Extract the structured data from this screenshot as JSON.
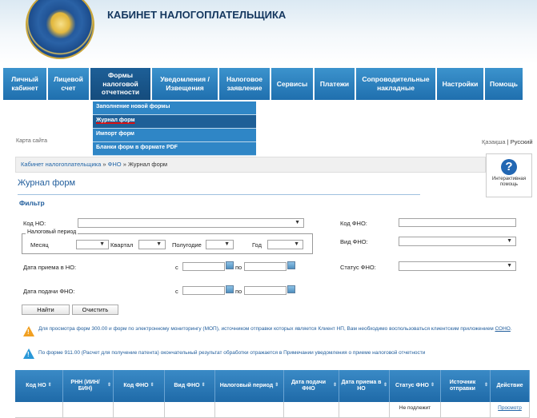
{
  "header": {
    "title": "КАБИНЕТ НАЛОГОПЛАТЕЛЬЩИКА"
  },
  "nav": {
    "items": [
      {
        "label": "Личный кабинет"
      },
      {
        "label": "Лицевой счет"
      },
      {
        "label": "Формы налоговой отчетности"
      },
      {
        "label": "Уведомления / Извещения"
      },
      {
        "label": "Налоговое заявление"
      },
      {
        "label": "Сервисы"
      },
      {
        "label": "Платежи"
      },
      {
        "label": "Сопроводительные накладные"
      },
      {
        "label": "Настройки"
      },
      {
        "label": "Помощь"
      }
    ]
  },
  "dropdown": {
    "items": [
      {
        "label": "Заполнение новой формы"
      },
      {
        "label": "Журнал форм"
      },
      {
        "label": "Импорт форм"
      },
      {
        "label": "Бланки форм в формате PDF"
      }
    ]
  },
  "sitemap": "Карта сайта",
  "lang": {
    "kz": "Қазақша",
    "sep": "|",
    "ru": "Русский"
  },
  "breadcrumb": {
    "home": "Кабинет налогоплательщика",
    "sep1": "»",
    "fno": "ФНО",
    "sep2": "»",
    "current": "Журнал форм"
  },
  "help": {
    "icon": "?",
    "label": "Интерактивная помощь"
  },
  "page": {
    "title": "Журнал форм"
  },
  "filter": {
    "heading": "Фильтр",
    "kod_no_label": "Код НО:",
    "period_legend": "Налоговый период",
    "month_label": "Месяц",
    "quarter_label": "Квартал",
    "halfyear_label": "Полугодие",
    "year_label": "Год",
    "date_received_label": "Дата приема в НО:",
    "date_submitted_label": "Дата подачи ФНО:",
    "from_label": "с",
    "to_label": "по",
    "kod_fno_label": "Код ФНО:",
    "vid_fno_label": "Вид ФНО:",
    "status_fno_label": "Статус ФНО:",
    "find_button": "Найти",
    "clear_button": "Очистить"
  },
  "notices": {
    "warning_text": "Для просмотра форм 300.00 и форм по электронному мониторингу (МОП), источником отправки которых является Клиент НП, Вам необходимо воспользоваться клиентским приложением",
    "warning_link": "СОНО",
    "warning_end": ".",
    "info_text": "По форме 911.00 (Расчет для получение патента) окончательный результат обработки отражается в Примечании уведомления о приеме налоговой отчетности"
  },
  "table": {
    "headers": [
      "Код НО",
      "РНН (ИИН/БИН)",
      "Код ФНО",
      "Вид ФНО",
      "Налоговый период",
      "Дата подачи ФНО",
      "Дата приема в НО",
      "Статус ФНО",
      "Источник отправки",
      "Действие"
    ],
    "row": {
      "status": "Не подлежит",
      "action": "Просмотр"
    }
  },
  "colors": {
    "nav": "#2b80c0",
    "nav_active": "#1a578d",
    "title": "#1f5c9b",
    "warning": "#f1a022",
    "info": "#2a98d8"
  }
}
